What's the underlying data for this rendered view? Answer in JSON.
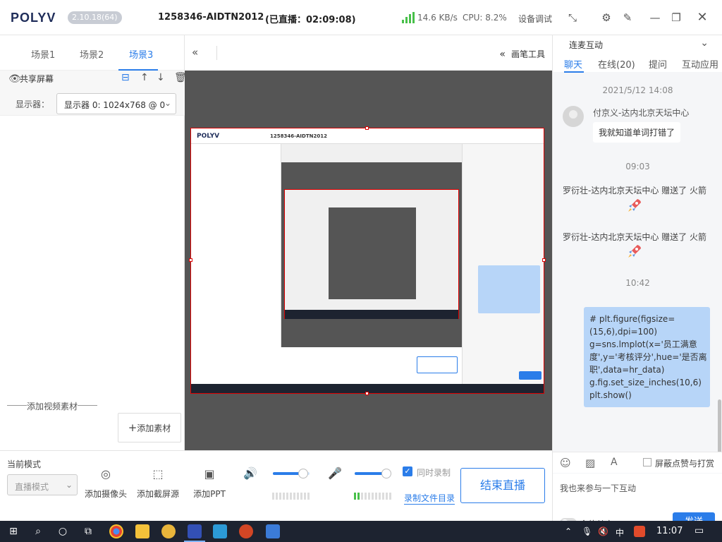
{
  "titlebar": {
    "logo": "POLYV",
    "version": "2.10.18(64)",
    "room": "1258346-AIDTN2012",
    "live_status": "(已直播：02:09:08)",
    "speed": "14.6 KB/s",
    "cpu": "CPU: 8.2%",
    "device_debug": "设备调试",
    "icons": [
      "shrink-icon",
      "gear-icon",
      "pin-icon",
      "minimize-icon",
      "maximize-icon",
      "close-icon"
    ]
  },
  "left": {
    "scene_tabs": [
      "场景1",
      "场景2",
      "场景3"
    ],
    "active_scene": "场景3",
    "layer_name": "共享屏幕",
    "display_label": "显示器：",
    "display_value": "显示器 0: 1024x768 @ 0",
    "add_video_label": "添加视频素材",
    "add_material_button": "添加素材"
  },
  "center": {
    "paint_tools": "画笔工具"
  },
  "bottom": {
    "mode_label": "当前模式",
    "mode_value": "直播模式",
    "tools": [
      {
        "label": "添加摄像头",
        "icon": "camera-icon"
      },
      {
        "label": "添加截屏源",
        "icon": "screenshot-icon"
      },
      {
        "label": "添加PPT",
        "icon": "ppt-icon"
      }
    ],
    "speaker_volume": 0.82,
    "mic_volume": 0.86,
    "sync_record": "同时录制",
    "record_dir": "录制文件目录",
    "end_live": "结束直播"
  },
  "right": {
    "title": "连麦互动",
    "tabs": [
      "聊天",
      "在线(20)",
      "提问",
      "互动应用"
    ],
    "active_tab": "聊天",
    "messages": {
      "ts1": "2021/5/12 14:08",
      "user1": "付京义-达内北京天坛中心",
      "msg1": "我就知道单词打错了",
      "ts2": "09:03",
      "gift1": "罗衍壮-达内北京天坛中心 赠送了 火箭",
      "gift2": "罗衍壮-达内北京天坛中心 赠送了 火箭",
      "ts3": "10:42",
      "code": "# plt.figure(figsize=\n(15,6),dpi=100)\ng=sns.lmplot(x='员工满意\n度',y='考核评分',hue='是否离\n职',data=hr_data)\ng.fig.set_size_inches(10,6)\nplt.show()"
    },
    "block_label": "屏蔽点赞与打赏",
    "input_text": "我也来参与一下互动",
    "mute_all": "全体禁言",
    "send": "发送"
  },
  "taskbar": {
    "time": "11:07",
    "ime": "中"
  },
  "colors": {
    "accent": "#2b7de9",
    "frame": "#dd0000",
    "taskbar": "#1d2330"
  }
}
